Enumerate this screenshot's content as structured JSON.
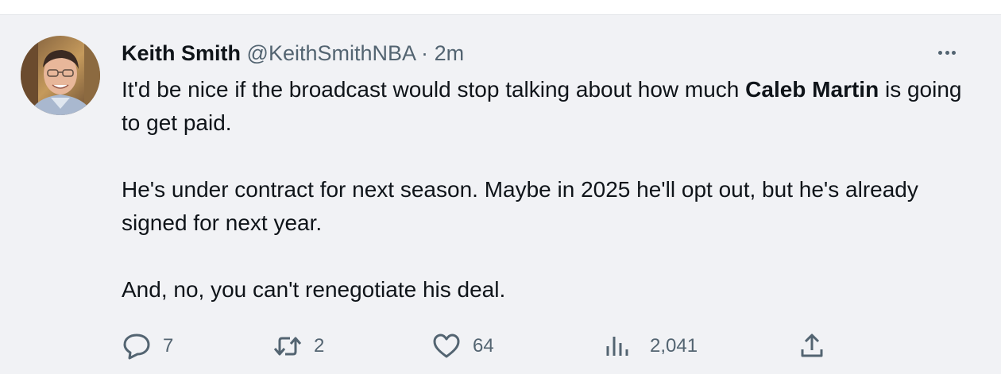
{
  "tweet": {
    "author_name": "Keith Smith",
    "author_handle": "@KeithSmithNBA",
    "separator": "·",
    "time": "2m",
    "line1_prefix": "It'd be nice if the broadcast would stop talking about how much ",
    "line1_bold": "Caleb Martin",
    "line1_suffix": " is going to get paid.",
    "paragraph2": "He's under contract for next season. Maybe in 2025 he'll opt out, but he's already signed for next year.",
    "paragraph3": "And, no, you can't renegotiate his deal."
  },
  "actions": {
    "replies": "7",
    "retweets": "2",
    "likes": "64",
    "views": "2,041"
  },
  "icons": {
    "more": "more-options-icon",
    "reply": "reply-icon",
    "retweet": "retweet-icon",
    "like": "heart-icon",
    "views": "views-bar-chart-icon",
    "share": "share-upload-icon"
  },
  "colors": {
    "card_background": "#f1f2f5",
    "text_primary": "#0f1419",
    "text_secondary": "#536471"
  }
}
